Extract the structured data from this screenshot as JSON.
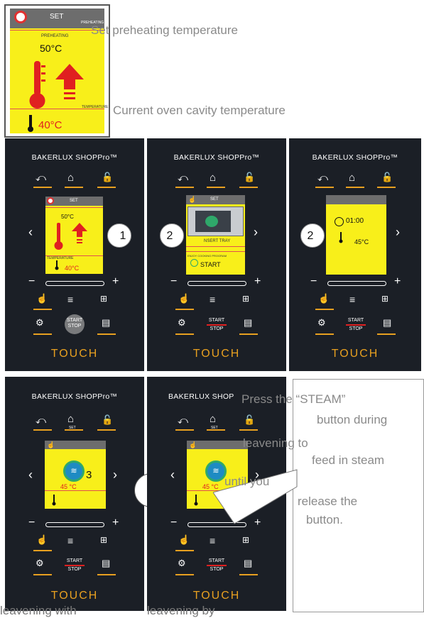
{
  "zoom": {
    "set_label": "SET",
    "preheating_small": "PREHEATING",
    "preheating_label": "PREHEATING",
    "preheat_temp": "50°C",
    "temperature_label": "TEMPERATURE",
    "current_temp": "40°C"
  },
  "callouts": {
    "preheat": "Set preheating temperature",
    "cavity": "Current oven cavity temperature"
  },
  "panels": [
    {
      "brand": "BAKERLUX SHOPPro™",
      "touch": "TOUCH",
      "screen": {
        "set": "SET",
        "preheat": "50°C",
        "temp_label": "TEMPERATURE",
        "temp": "40°C"
      },
      "step": "1",
      "start": "START",
      "stop": "STOP"
    },
    {
      "brand": "BAKERLUX SHOPPro™",
      "touch": "TOUCH",
      "screen": {
        "set": "SET",
        "insert": "NSERT TRAY",
        "prog": "ENJOY COOKING PROGRAM",
        "start": "START"
      },
      "step": "2",
      "start": "START",
      "stop": "STOP"
    },
    {
      "brand": "BAKERLUX SHOPPro™",
      "touch": "TOUCH",
      "screen": {
        "time": "01:00",
        "temp": "45°C"
      },
      "step": "2",
      "start": "START",
      "stop": "STOP"
    },
    {
      "brand": "BAKERLUX SHOPPro™",
      "touch": "TOUCH",
      "screen": {
        "temp": "45 °C",
        "set": "SET"
      },
      "step": "3",
      "start": "START",
      "stop": "STOP"
    },
    {
      "brand": "BAKERLUX SHOP",
      "touch": "TOUCH",
      "screen": {
        "temp": "45 °C",
        "set": "SET"
      },
      "start": "START",
      "stop": "STOP"
    }
  ],
  "steam_note": {
    "line1": "Press the “STEAM”",
    "line2": "button during",
    "line3": "leavening to",
    "line4": "feed in steam",
    "line5": "until you",
    "line6": "release the",
    "line7": "button."
  },
  "bottom": {
    "left": "leavening with",
    "right": "leavening by"
  },
  "colors": {
    "panel_bg": "#1b1f26",
    "screen_yellow": "#f8ef1a",
    "accent_orange": "#e8a020",
    "thermo_red": "#e02020"
  }
}
